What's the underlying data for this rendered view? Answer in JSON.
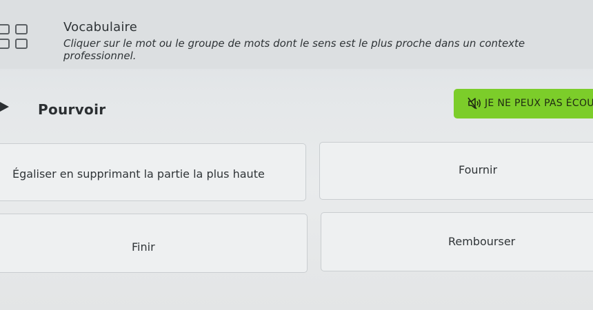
{
  "header": {
    "title": "Vocabulaire",
    "instruction": "Cliquer sur le mot ou le groupe de mots dont le sens est le plus proche dans un contexte professionnel."
  },
  "question": {
    "word": "Pourvoir",
    "play_icon": "play-triangle-icon"
  },
  "cant_listen": {
    "label": "JE NE PEUX PAS ÉCOUTER",
    "icon": "speaker-muted-icon",
    "color": "#7ccd2a"
  },
  "answers": [
    {
      "label": "Égaliser en supprimant la partie la plus haute"
    },
    {
      "label": "Fournir"
    },
    {
      "label": "Finir"
    },
    {
      "label": "Rembourser"
    }
  ],
  "module_icon": "grid-squares-icon"
}
